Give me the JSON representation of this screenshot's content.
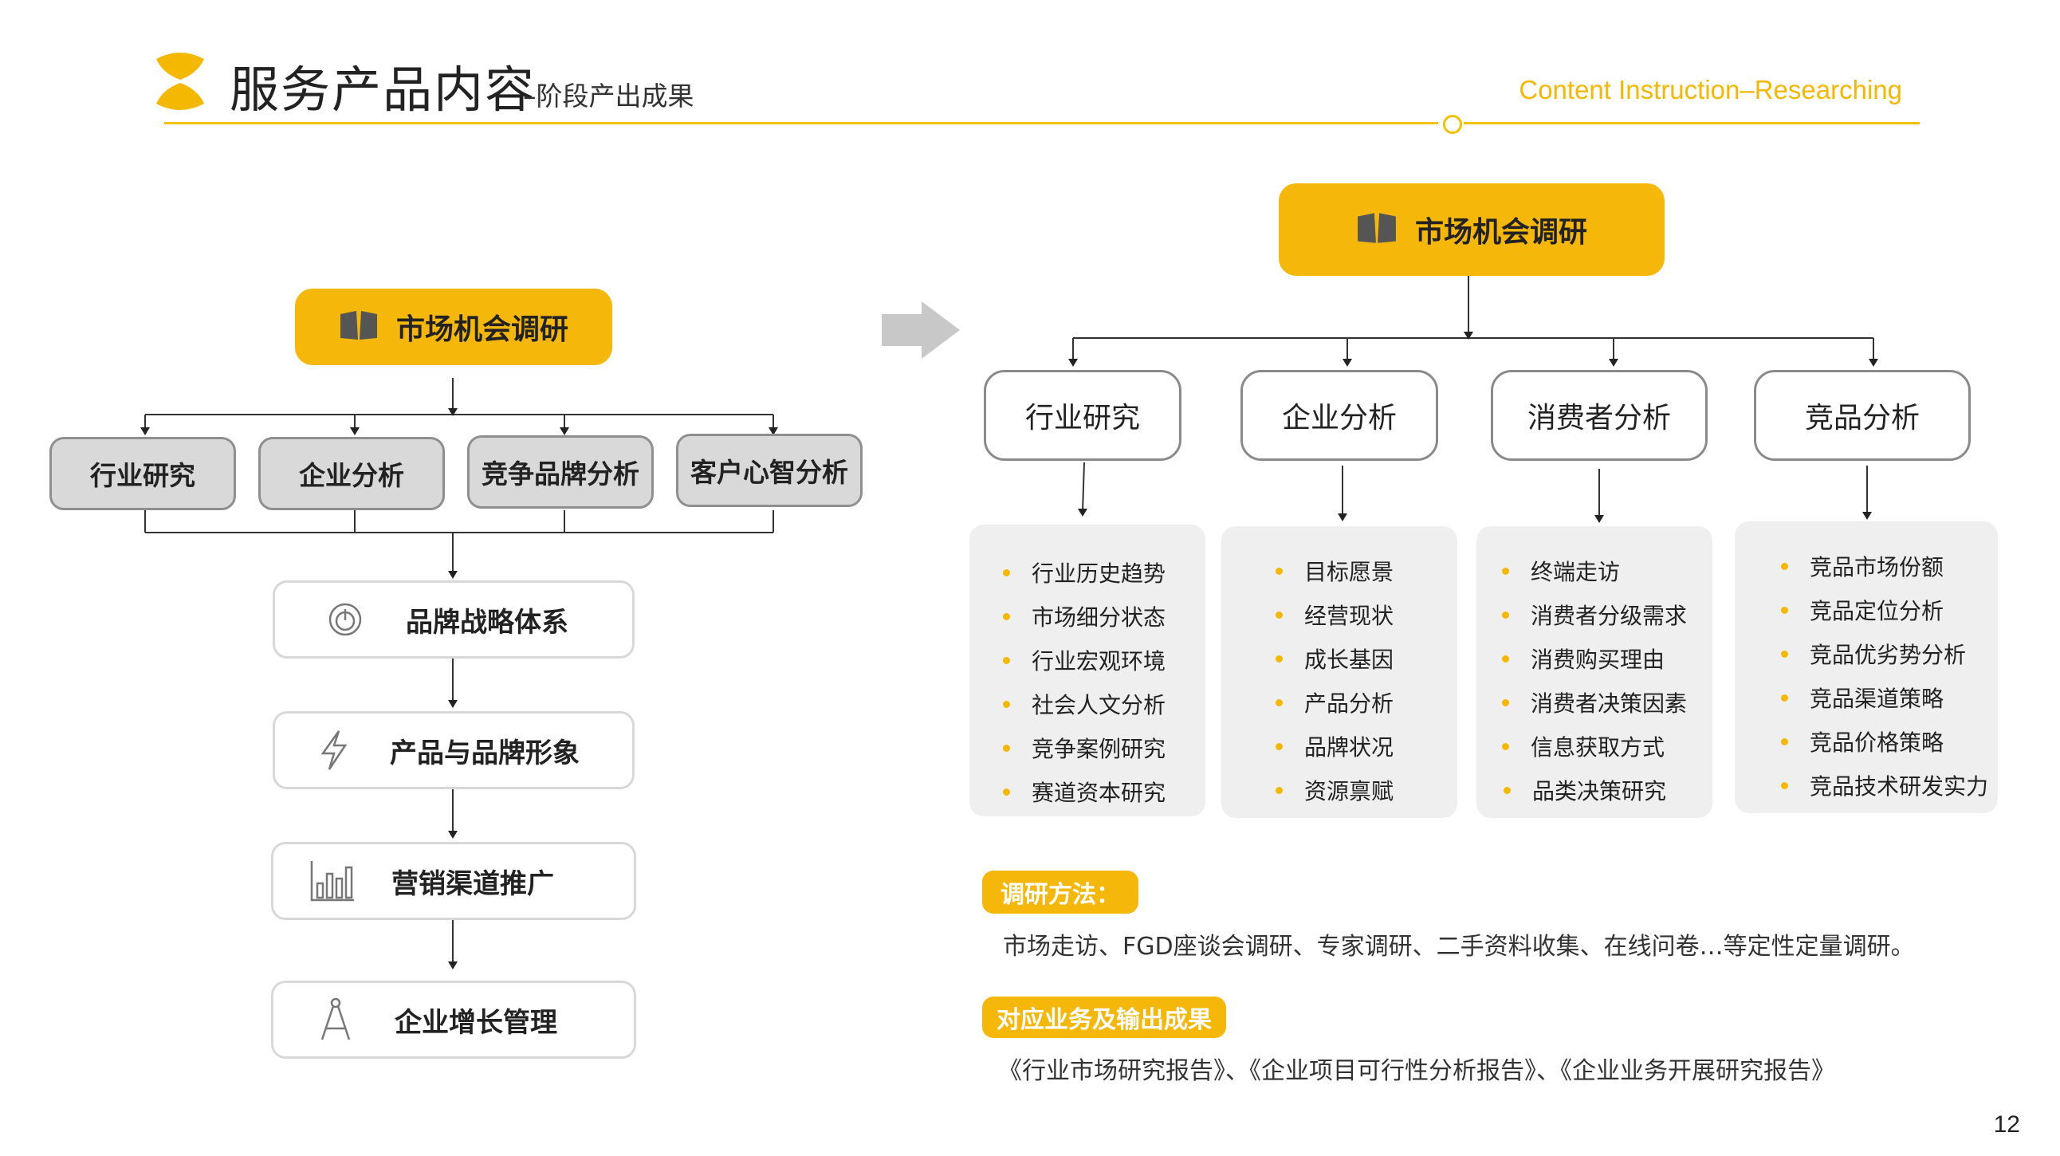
{
  "header": {
    "title": "服务产品内容",
    "subtitle": "–阶段产出成果",
    "en_title": "Content Instruction–Researching",
    "page_number": "12"
  },
  "left": {
    "root": {
      "label": "市场机会调研",
      "icon": "book-icon"
    },
    "categories": [
      {
        "label": "行业研究"
      },
      {
        "label": "企业分析"
      },
      {
        "label": "竞争品牌分析"
      },
      {
        "label": "客户心智分析"
      }
    ],
    "stages": [
      {
        "label": "品牌战略体系",
        "icon": "power-icon"
      },
      {
        "label": "产品与品牌形象",
        "icon": "lightning-icon"
      },
      {
        "label": "营销渠道推广",
        "icon": "bar-chart-icon"
      },
      {
        "label": "企业增长管理",
        "icon": "compass-icon"
      }
    ]
  },
  "right": {
    "root": {
      "label": "市场机会调研",
      "icon": "book-icon"
    },
    "branches": [
      {
        "label": "行业研究",
        "items": [
          "行业历史趋势",
          "市场细分状态",
          "行业宏观环境",
          "社会人文分析",
          "竞争案例研究",
          "赛道资本研究"
        ]
      },
      {
        "label": "企业分析",
        "items": [
          "目标愿景",
          "经营现状",
          "成长基因",
          "产品分析",
          "品牌状况",
          "资源禀赋"
        ]
      },
      {
        "label": "消费者分析",
        "items": [
          "终端走访",
          "消费者分级需求",
          "消费购买理由",
          "消费者决策因素",
          "信息获取方式",
          "品类决策研究"
        ]
      },
      {
        "label": "竞品分析",
        "items": [
          "竞品市场份额",
          "竞品定位分析",
          "竞品优劣势分析",
          "竞品渠道策略",
          "竞品价格策略",
          "竞品技术研发实力"
        ]
      }
    ]
  },
  "methods": {
    "tag": "调研方法：",
    "text": "市场走访、FGD座谈会调研、专家调研、二手资料收集、在线问卷…等定性定量调研。"
  },
  "outputs": {
    "tag": "对应业务及输出成果",
    "text": "《行业市场研究报告》、《企业项目可行性分析报告》、《企业业务开展研究报告》"
  },
  "colors": {
    "accent": "#f5b80a",
    "grey_box": "#d9d9d9",
    "panel": "#efefef"
  }
}
